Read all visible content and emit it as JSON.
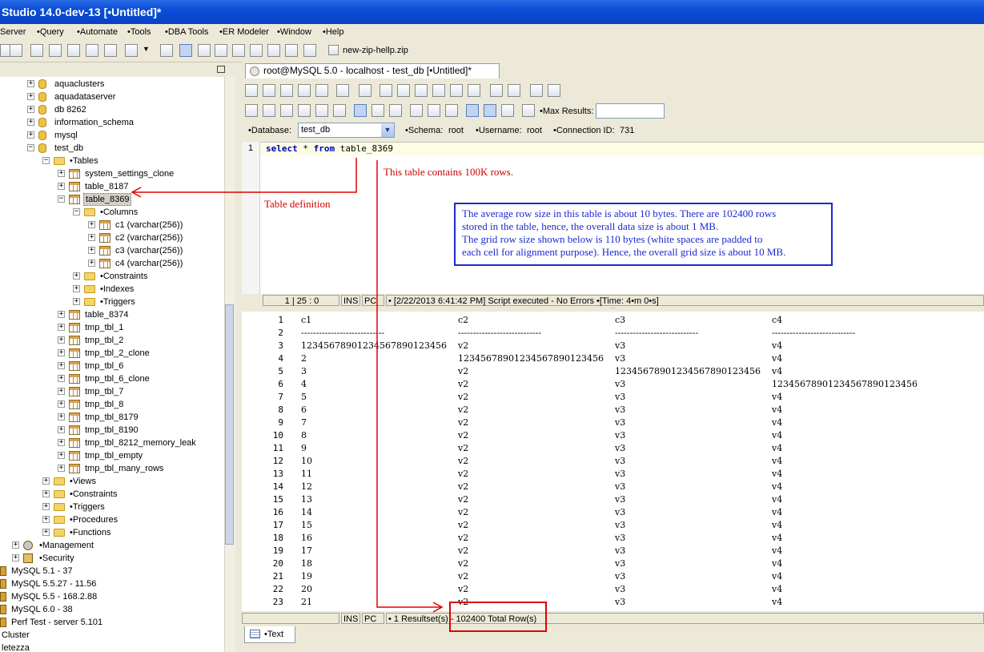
{
  "window": {
    "title": "Studio 14.0-dev-13 [•Untitled]*"
  },
  "menu": [
    "Server",
    "•Query",
    "•Automate",
    "•Tools",
    "•DBA Tools",
    "•ER Modeler",
    "•Window",
    "•Help"
  ],
  "toolbar": {
    "zip_label": "new-zip-hellp.zip"
  },
  "tree": {
    "items": [
      {
        "label": "aquaclusters",
        "depth": 2,
        "icon": "db"
      },
      {
        "label": "aquadataserver",
        "depth": 2,
        "icon": "db"
      },
      {
        "label": "db 8262",
        "depth": 2,
        "icon": "db"
      },
      {
        "label": "information_schema",
        "depth": 2,
        "icon": "db"
      },
      {
        "label": "mysql",
        "depth": 2,
        "icon": "db"
      },
      {
        "label": "test_db",
        "depth": 2,
        "icon": "db",
        "expanded": true
      },
      {
        "label": "•Tables",
        "depth": 3,
        "icon": "folder",
        "expanded": true
      },
      {
        "label": "system_settings_clone",
        "depth": 4,
        "icon": "table"
      },
      {
        "label": "table_8187",
        "depth": 4,
        "icon": "table"
      },
      {
        "label": "table_8369",
        "depth": 4,
        "icon": "table",
        "expanded": true,
        "selected": true
      },
      {
        "label": "•Columns",
        "depth": 5,
        "icon": "folder",
        "expanded": true
      },
      {
        "label": "c1 (varchar(256))",
        "depth": 6,
        "icon": "table"
      },
      {
        "label": "c2 (varchar(256))",
        "depth": 6,
        "icon": "table"
      },
      {
        "label": "c3 (varchar(256))",
        "depth": 6,
        "icon": "table"
      },
      {
        "label": "c4 (varchar(256))",
        "depth": 6,
        "icon": "table"
      },
      {
        "label": "•Constraints",
        "depth": 5,
        "icon": "folder"
      },
      {
        "label": "•Indexes",
        "depth": 5,
        "icon": "folder"
      },
      {
        "label": "•Triggers",
        "depth": 5,
        "icon": "folder"
      },
      {
        "label": "table_8374",
        "depth": 4,
        "icon": "table"
      },
      {
        "label": "tmp_tbl_1",
        "depth": 4,
        "icon": "table"
      },
      {
        "label": "tmp_tbl_2",
        "depth": 4,
        "icon": "table"
      },
      {
        "label": "tmp_tbl_2_clone",
        "depth": 4,
        "icon": "table"
      },
      {
        "label": "tmp_tbl_6",
        "depth": 4,
        "icon": "table"
      },
      {
        "label": "tmp_tbl_6_clone",
        "depth": 4,
        "icon": "table"
      },
      {
        "label": "tmp_tbl_7",
        "depth": 4,
        "icon": "table"
      },
      {
        "label": "tmp_tbl_8",
        "depth": 4,
        "icon": "table"
      },
      {
        "label": "tmp_tbl_8179",
        "depth": 4,
        "icon": "table"
      },
      {
        "label": "tmp_tbl_8190",
        "depth": 4,
        "icon": "table"
      },
      {
        "label": "tmp_tbl_8212_memory_leak",
        "depth": 4,
        "icon": "table"
      },
      {
        "label": "tmp_tbl_empty",
        "depth": 4,
        "icon": "table"
      },
      {
        "label": "tmp_tbl_many_rows",
        "depth": 4,
        "icon": "table"
      },
      {
        "label": "•Views",
        "depth": 3,
        "icon": "folder"
      },
      {
        "label": "•Constraints",
        "depth": 3,
        "icon": "folder"
      },
      {
        "label": "•Triggers",
        "depth": 3,
        "icon": "folder"
      },
      {
        "label": "•Procedures",
        "depth": 3,
        "icon": "folder"
      },
      {
        "label": "•Functions",
        "depth": 3,
        "icon": "folder"
      },
      {
        "label": "•Management",
        "depth": 1,
        "icon": "gear"
      },
      {
        "label": "•Security",
        "depth": 1,
        "icon": "lock"
      },
      {
        "label": "MySQL 5.1 - 37",
        "depth": 0,
        "icon": "server"
      },
      {
        "label": "MySQL 5.5.27 - 11.56",
        "depth": 0,
        "icon": "server"
      },
      {
        "label": "MySQL 5.5 - 168.2.88",
        "depth": 0,
        "icon": "server"
      },
      {
        "label": "MySQL 6.0 - 38",
        "depth": 0,
        "icon": "server"
      },
      {
        "label": "Perf Test - server 5.101",
        "depth": 0,
        "icon": "server"
      },
      {
        "label": "Cluster",
        "depth": 0,
        "icon": "none"
      },
      {
        "label": "letezza",
        "depth": 0,
        "icon": "none"
      }
    ]
  },
  "editor": {
    "tab_title": "root@MySQL 5.0 - localhost - test_db [•Untitled]*",
    "database_label": "•Database:",
    "database_value": "test_db",
    "schema_label": "•Schema:",
    "schema_value": "root",
    "username_label": "•Username:",
    "username_value": "root",
    "connection_label": "•Connection ID:",
    "connection_value": "731",
    "max_results_label": "•Max Results:",
    "max_results_value": "",
    "line_number": "1",
    "sql_select": "select",
    "sql_star": " * ",
    "sql_from": "from",
    "sql_table": " table_8369"
  },
  "status1": {
    "position": "1 | 25 : 0",
    "ins": "INS",
    "pc": "PC",
    "message": "• [2/22/2013 6:41:42 PM] Script executed - No Errors •[Time: 4•m 0•s]"
  },
  "grid": {
    "rows": [
      [
        "1",
        "c1",
        "c2",
        "c3",
        "c4"
      ],
      [
        "2",
        "----------------------------",
        "----------------------------",
        "----------------------------",
        "----------------------------"
      ],
      [
        "3",
        "12345678901234567890123456",
        "v2",
        "v3",
        "v4"
      ],
      [
        "4",
        "2",
        "12345678901234567890123456",
        "v3",
        "v4"
      ],
      [
        "5",
        "3",
        "v2",
        "12345678901234567890123456",
        "v4"
      ],
      [
        "6",
        "4",
        "v2",
        "v3",
        "12345678901234567890123456"
      ],
      [
        "7",
        "5",
        "v2",
        "v3",
        "v4"
      ],
      [
        "8",
        "6",
        "v2",
        "v3",
        "v4"
      ],
      [
        "9",
        "7",
        "v2",
        "v3",
        "v4"
      ],
      [
        "10",
        "8",
        "v2",
        "v3",
        "v4"
      ],
      [
        "11",
        "9",
        "v2",
        "v3",
        "v4"
      ],
      [
        "12",
        "10",
        "v2",
        "v3",
        "v4"
      ],
      [
        "13",
        "11",
        "v2",
        "v3",
        "v4"
      ],
      [
        "14",
        "12",
        "v2",
        "v3",
        "v4"
      ],
      [
        "15",
        "13",
        "v2",
        "v3",
        "v4"
      ],
      [
        "16",
        "14",
        "v2",
        "v3",
        "v4"
      ],
      [
        "17",
        "15",
        "v2",
        "v3",
        "v4"
      ],
      [
        "18",
        "16",
        "v2",
        "v3",
        "v4"
      ],
      [
        "19",
        "17",
        "v2",
        "v3",
        "v4"
      ],
      [
        "20",
        "18",
        "v2",
        "v3",
        "v4"
      ],
      [
        "21",
        "19",
        "v2",
        "v3",
        "v4"
      ],
      [
        "22",
        "20",
        "v2",
        "v3",
        "v4"
      ],
      [
        "23",
        "21",
        "v2",
        "v3",
        "v4"
      ]
    ]
  },
  "status2": {
    "ins": "INS",
    "pc": "PC",
    "message": "• 1 Resultset(s) - 102400 Total Row(s)"
  },
  "bottom_tab": {
    "label": "•Text"
  },
  "annotations": {
    "rows_note": "This table contains 100K rows.",
    "table_definition": "Table definition",
    "size_note_1": "The average row size in this table is about 10 bytes. There are 102400 rows",
    "size_note_2": "stored in the table, hence, the overall data size is about 1 MB.",
    "size_note_3": "The grid row size shown below is 110 bytes (white spaces are padded to",
    "size_note_4": "each cell for alignment purpose). Hence, the overall grid size is about 10 MB."
  },
  "colors": {
    "annotation_red": "#d00000",
    "note_blue": "#1a2ad0",
    "title_blue": "#0a4ed8"
  }
}
